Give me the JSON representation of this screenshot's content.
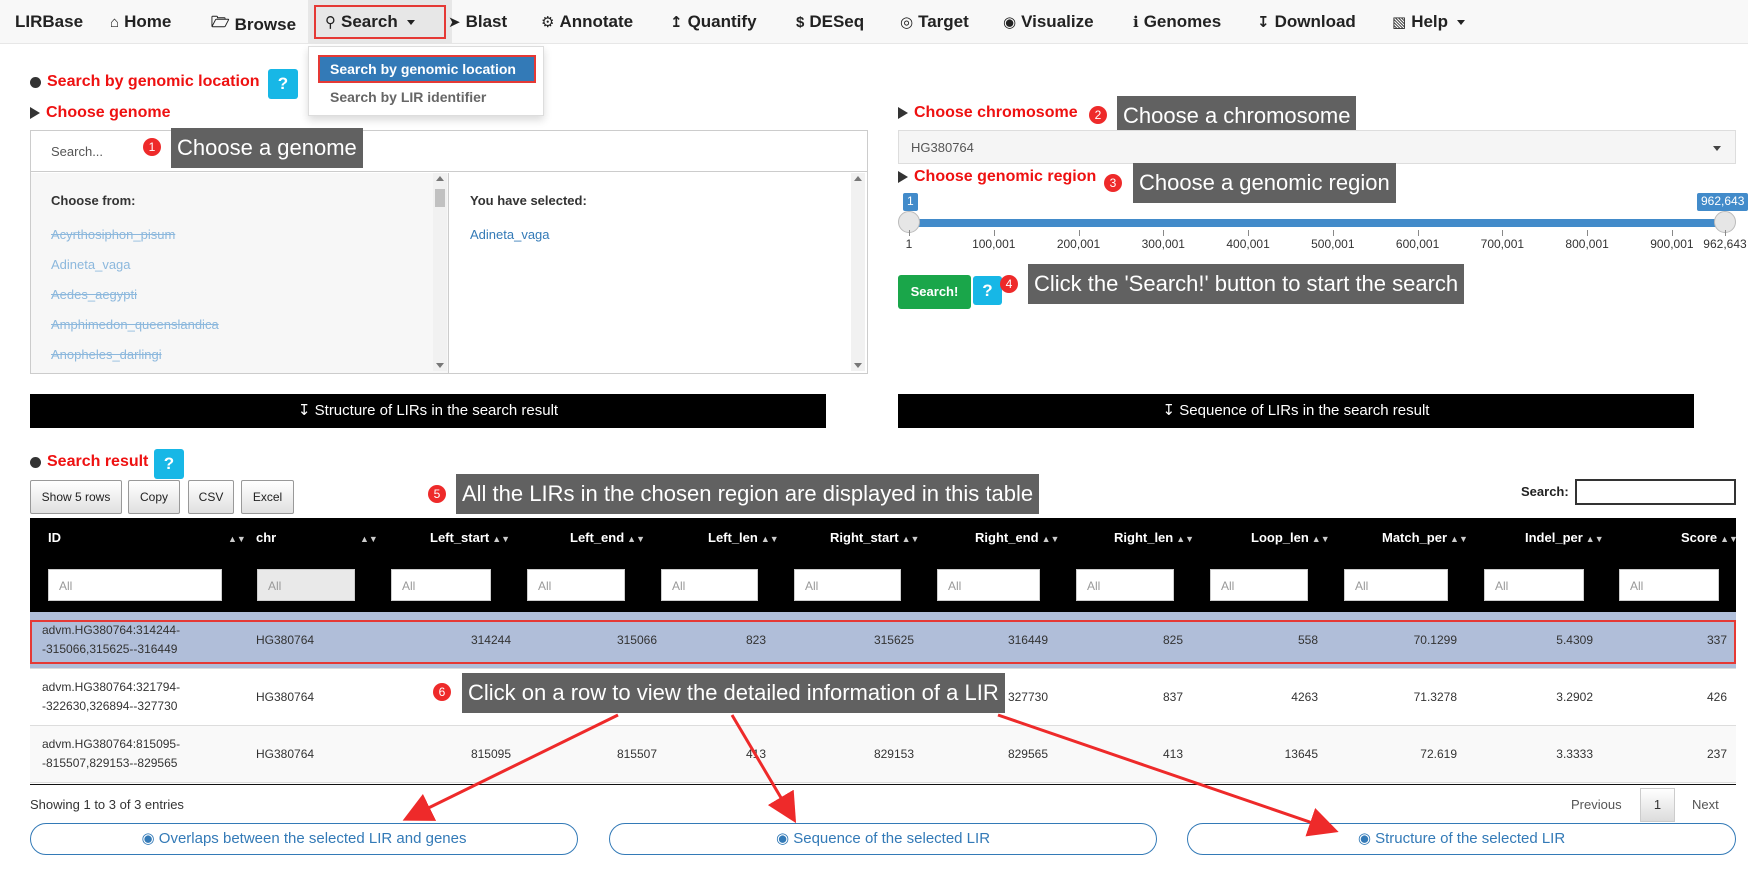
{
  "nav": {
    "brand": "LIRBase",
    "items": [
      {
        "label": "Home",
        "icon": "home-icon"
      },
      {
        "label": "Browse",
        "icon": "folder-open-icon"
      },
      {
        "label": "Search",
        "icon": "search-icon"
      },
      {
        "label": "Blast",
        "icon": "rocket-icon"
      },
      {
        "label": "Annotate",
        "icon": "cogs-icon"
      },
      {
        "label": "Quantify",
        "icon": "upload-icon"
      },
      {
        "label": "DESeq",
        "icon": "dollar-square-icon"
      },
      {
        "label": "Target",
        "icon": "target-icon"
      },
      {
        "label": "Visualize",
        "icon": "eye-icon"
      },
      {
        "label": "Genomes",
        "icon": "info-icon"
      },
      {
        "label": "Download",
        "icon": "download-icon"
      },
      {
        "label": "Help",
        "icon": "book-icon"
      }
    ],
    "dropdown": {
      "active": "Search by genomic location",
      "other": "Search by LIR identifier"
    }
  },
  "page": {
    "title": "Search by genomic location",
    "help": "?"
  },
  "genome": {
    "header": "Choose genome",
    "search_placeholder": "Search...",
    "choose_from": "Choose from:",
    "options": [
      "Acyrthosiphon_pisum",
      "Adineta_vaga",
      "Aedes_aegypti",
      "Amphimedon_queenslandica",
      "Anopheles_darlingi"
    ],
    "selected_header": "You have selected:",
    "selected": [
      "Adineta_vaga"
    ]
  },
  "chromosome": {
    "header": "Choose chromosome",
    "value": "HG380764"
  },
  "region": {
    "header": "Choose genomic region",
    "min": "1",
    "max": "962,643",
    "ticks": [
      "1",
      "100,001",
      "200,001",
      "300,001",
      "400,001",
      "500,001",
      "600,001",
      "700,001",
      "800,001",
      "900,001",
      "962,643"
    ]
  },
  "search_button": "Search!",
  "callouts": [
    {
      "num": "1",
      "text": "Choose a genome"
    },
    {
      "num": "2",
      "text": "Choose a chromosome"
    },
    {
      "num": "3",
      "text": "Choose a genomic region"
    },
    {
      "num": "4",
      "text": "Click the 'Search!' button to start the search"
    },
    {
      "num": "5",
      "text": "All the LIRs in the chosen region are displayed in this table"
    },
    {
      "num": "6",
      "text": "Click on a row to view the detailed information of a LIR"
    }
  ],
  "downloads": {
    "structure": "Structure of LIRs in the search result",
    "sequence": "Sequence of LIRs in the search result"
  },
  "result": {
    "title": "Search result",
    "buttons": [
      "Show 5 rows",
      "Copy",
      "CSV",
      "Excel"
    ],
    "search_label": "Search:",
    "filter_placeholder": "All",
    "columns": [
      "ID",
      "chr",
      "Left_start",
      "Left_end",
      "Left_len",
      "Right_start",
      "Right_end",
      "Right_len",
      "Loop_len",
      "Match_per",
      "Indel_per",
      "Score"
    ],
    "rows": [
      [
        "advm.HG380764:314244--315066,315625--316449",
        "HG380764",
        "314244",
        "315066",
        "823",
        "315625",
        "316449",
        "825",
        "558",
        "70.1299",
        "5.4309",
        "337"
      ],
      [
        "advm.HG380764:321794--322630,326894--327730",
        "HG380764",
        "321794",
        "322630",
        "837",
        "326894",
        "327730",
        "837",
        "4263",
        "71.3278",
        "3.2902",
        "426"
      ],
      [
        "advm.HG380764:815095--815507,829153--829565",
        "HG380764",
        "815095",
        "815507",
        "413",
        "829153",
        "829565",
        "413",
        "13645",
        "72.619",
        "3.3333",
        "237"
      ]
    ],
    "info": "Showing 1 to 3 of 3 entries",
    "pagination": {
      "prev": "Previous",
      "current": "1",
      "next": "Next"
    }
  },
  "detail_buttons": {
    "overlaps": "Overlaps between the selected LIR and genes",
    "sequence": "Sequence of the selected LIR",
    "structure": "Structure of the selected LIR"
  },
  "colors": {
    "accent_red": "#ee1111",
    "primary_blue": "#337ab7",
    "help_cyan": "#17b7e6",
    "search_green": "#1aa64a",
    "callout_gray": "#616161",
    "selected_row": "#b0bed9"
  }
}
